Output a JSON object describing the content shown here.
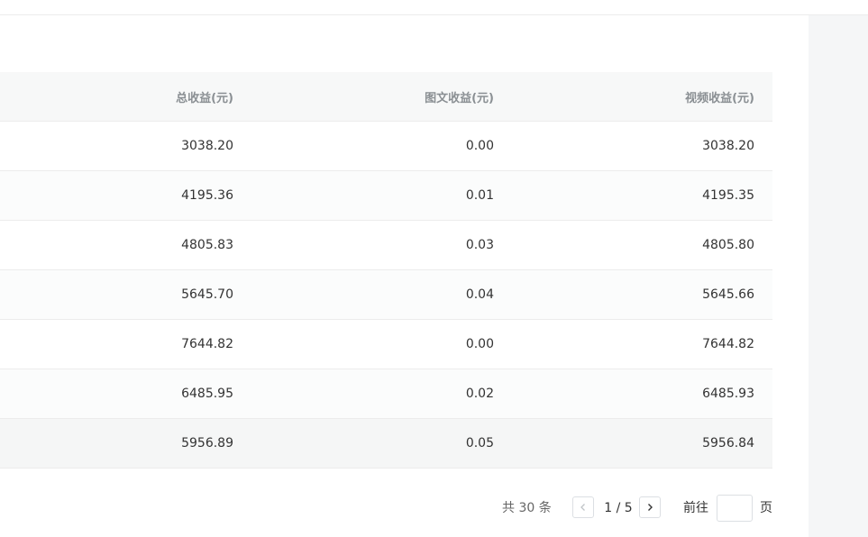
{
  "table": {
    "headers": [
      "总收益(元)",
      "图文收益(元)",
      "视频收益(元)"
    ],
    "rows": [
      [
        "3038.20",
        "0.00",
        "3038.20"
      ],
      [
        "4195.36",
        "0.01",
        "4195.35"
      ],
      [
        "4805.83",
        "0.03",
        "4805.80"
      ],
      [
        "5645.70",
        "0.04",
        "5645.66"
      ],
      [
        "7644.82",
        "0.00",
        "7644.82"
      ],
      [
        "6485.95",
        "0.02",
        "6485.93"
      ],
      [
        "5956.89",
        "0.05",
        "5956.84"
      ]
    ]
  },
  "pagination": {
    "total_label": "共 30 条",
    "pages_label": "1 / 5",
    "goto_label": "前往",
    "goto_value": "",
    "page_unit": "页",
    "prev_icon": "chevron-left-icon",
    "next_icon": "chevron-right-icon"
  }
}
